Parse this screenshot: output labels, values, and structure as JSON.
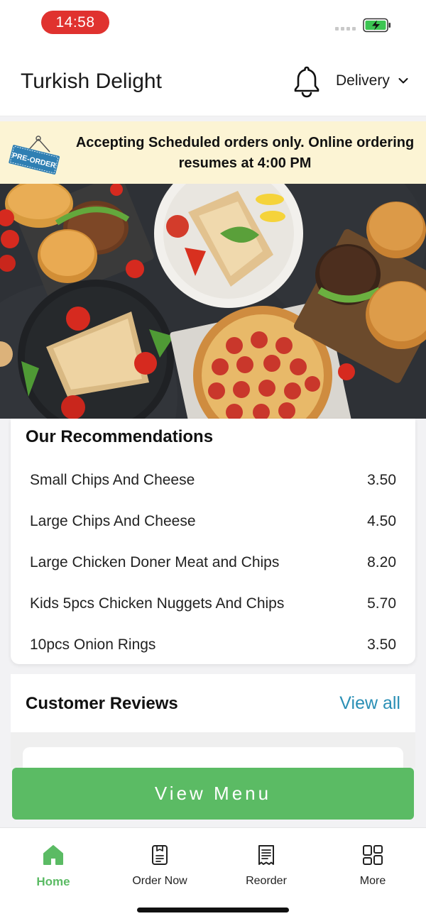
{
  "status_bar": {
    "time": "14:58"
  },
  "header": {
    "title": "Turkish Delight",
    "mode": "Delivery"
  },
  "banner": {
    "tag": "PRE-ORDER",
    "message": "Accepting Scheduled orders only. Online ordering resumes at 4:00 PM"
  },
  "recommendations": {
    "title": "Our Recommendations",
    "items": [
      {
        "name": "Small Chips And Cheese",
        "price": "3.50"
      },
      {
        "name": "Large Chips And Cheese",
        "price": "4.50"
      },
      {
        "name": "Large Chicken Doner Meat and Chips",
        "price": "8.20"
      },
      {
        "name": "Kids 5pcs Chicken Nuggets And Chips",
        "price": "5.70"
      },
      {
        "name": "10pcs Onion Rings",
        "price": "3.50"
      }
    ]
  },
  "reviews": {
    "title": "Customer Reviews",
    "view_all": "View all"
  },
  "cta": {
    "label": "View Menu"
  },
  "tabs": [
    {
      "label": "Home",
      "icon": "home-icon",
      "active": true
    },
    {
      "label": "Order Now",
      "icon": "menu-card-icon",
      "active": false
    },
    {
      "label": "Reorder",
      "icon": "receipt-icon",
      "active": false
    },
    {
      "label": "More",
      "icon": "grid-icon",
      "active": false
    }
  ],
  "colors": {
    "accent_green": "#5bbb64",
    "link_blue": "#2a8fb5",
    "banner_bg": "#fcf4d4",
    "time_pill": "#e0322f"
  }
}
